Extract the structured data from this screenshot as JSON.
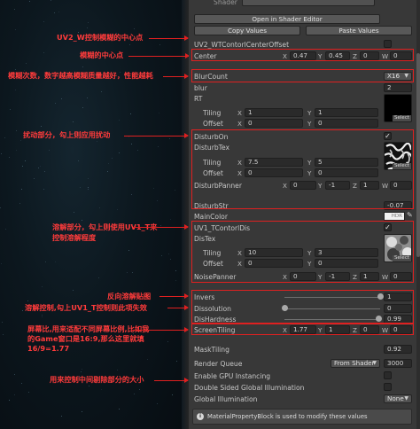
{
  "annotations": [
    "UV2_W控制模糊的中心点",
    "模糊的中心点",
    "模糊次数，数字越高模糊质量越好，性能越耗",
    "扰动部分，勾上则应用扰动",
    "溶解部分，勾上则使用UV1_T来控制溶解程度",
    "反向溶解贴图",
    "溶解控制,勾上UV1_T控制则此项失效",
    "屏幕比,用来适配不同屏幕比例,比如我的Game窗口是16:9,那么这里就填16/9=1.77",
    "用来控制中间剔除部分的大小"
  ],
  "inspector": {
    "shader_label": "Shader",
    "open_shader_editor": "Open in Shader Editor",
    "copy_values": "Copy Values",
    "paste_values": "Paste Values",
    "uv2_label": "UV2_WTContorlCenterOffset",
    "center": {
      "label": "Center",
      "x": "0.47",
      "y": "0.45",
      "z": "0",
      "w": "0"
    },
    "blur_count": {
      "label": "BlurCount",
      "value": "X16"
    },
    "blur": {
      "label": "blur",
      "value": "2"
    },
    "rt": {
      "label": "RT",
      "tiling_label": "Tiling",
      "tiling_x": "1",
      "tiling_y": "1",
      "offset_label": "Offset",
      "offset_x": "0",
      "offset_y": "0",
      "select": "Select"
    },
    "disturb_on": {
      "label": "DisturbOn"
    },
    "disturb_tex": {
      "label": "DisturbTex",
      "tiling_label": "Tiling",
      "tiling_x": "7.5",
      "tiling_y": "5",
      "offset_label": "Offset",
      "offset_x": "0",
      "offset_y": "0",
      "select": "Select"
    },
    "disturb_panner": {
      "label": "DisturbPanner",
      "x": "0",
      "y": "-1",
      "z": "1",
      "w": "0"
    },
    "disturb_str": {
      "label": "DisturbStr",
      "value": "-0.07"
    },
    "main_color": {
      "label": "MainColor",
      "hdr": "HDR"
    },
    "uv1_t": {
      "label": "UV1_TContorlDis"
    },
    "dis_tex": {
      "label": "DisTex",
      "tiling_label": "Tiling",
      "tiling_x": "10",
      "tiling_y": "3",
      "offset_label": "Offset",
      "offset_x": "0",
      "offset_y": "0",
      "select": "Select"
    },
    "noise_panner": {
      "label": "NoisePanner",
      "x": "0",
      "y": "-1",
      "z": "1",
      "w": "0"
    },
    "invers": {
      "label": "Invers",
      "value": "1",
      "fraction": 1.0
    },
    "dissolution": {
      "label": "Dissolution",
      "value": "0",
      "fraction": 0.0
    },
    "dis_hardness": {
      "label": "DisHardness",
      "value": "0.99",
      "fraction": 0.99
    },
    "screen_tiling": {
      "label": "ScreenTiling",
      "x": "1.77",
      "y": "1",
      "z": "0",
      "w": "0"
    },
    "mask_tiling": {
      "label": "MaskTiling",
      "value": "0.92"
    },
    "render_queue": {
      "label": "Render Queue",
      "mode": "From Shader",
      "value": "3000"
    },
    "gpu_instancing": {
      "label": "Enable GPU Instancing"
    },
    "double_sided_gi": {
      "label": "Double Sided Global Illumination"
    },
    "global_illumination": {
      "label": "Global Illumination",
      "value": "None"
    },
    "help_text": "MaterialPropertyBlock is used to modify these values"
  },
  "colors": {
    "accent_red": "#e02020",
    "panel": "#383838",
    "scene": "#0c171e"
  }
}
